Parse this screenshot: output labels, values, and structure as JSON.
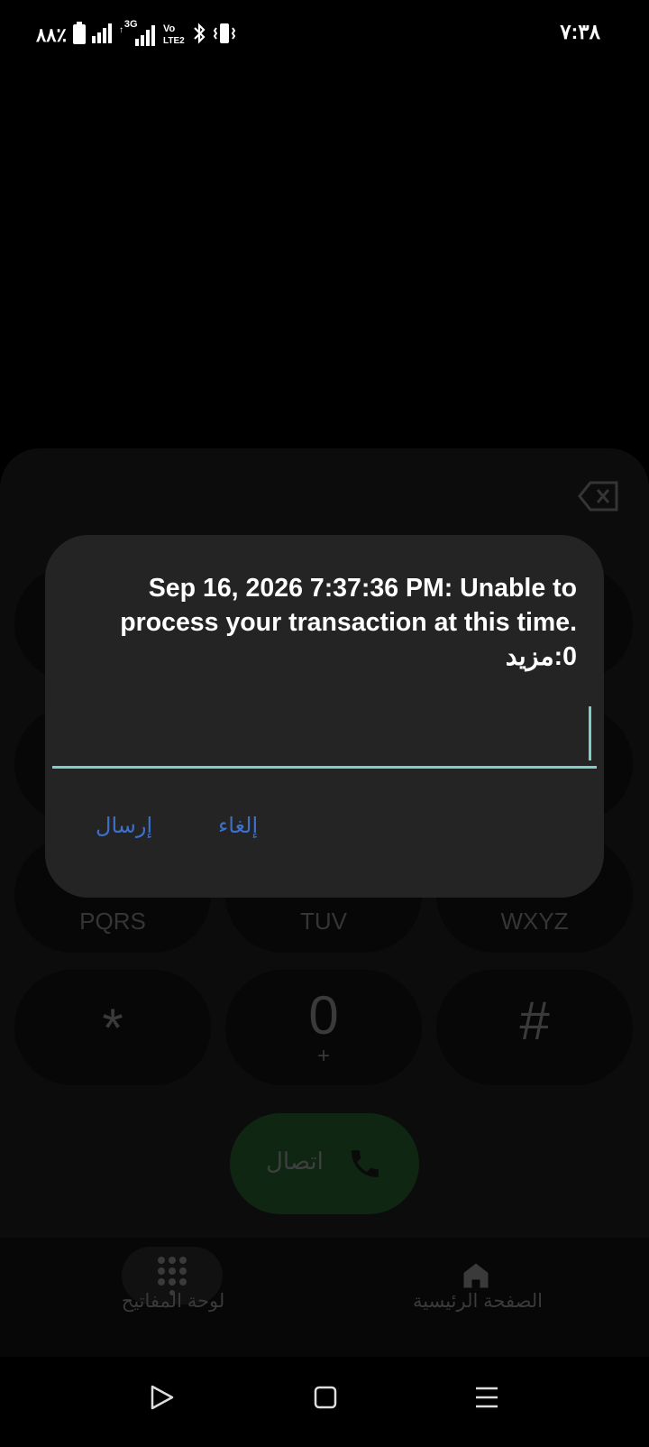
{
  "status_bar": {
    "battery_percent": "٨٨٪",
    "network": "3G",
    "volte": "Vo LTE2",
    "time": "٧:٣٨",
    "icons": [
      "battery-icon",
      "signal-icon",
      "signal-3g-icon",
      "volte-icon",
      "bluetooth-icon",
      "vibrate-icon"
    ]
  },
  "dialer": {
    "keys": [
      {
        "letters": "PQRS",
        "main": "",
        "sub": ""
      },
      {
        "letters": "TUV",
        "main": "",
        "sub": ""
      },
      {
        "letters": "WXYZ",
        "main": "",
        "sub": ""
      },
      {
        "letters": "",
        "main": "*",
        "sub": ""
      },
      {
        "letters": "",
        "main": "0",
        "sub": "+"
      },
      {
        "letters": "",
        "main": "#",
        "sub": ""
      }
    ],
    "call_label": "اتصال",
    "call_color": "#0e2612"
  },
  "bottom_nav": {
    "keypad_label": "لوحة المفاتيح",
    "home_label": "الصفحة الرئيسية"
  },
  "dialog": {
    "message_line1": "Sep 16, 2026 7:37:36 PM: Unable to",
    "message_line2": ".process your transaction at this time",
    "message_line3": "0:مزيد",
    "input_value": "",
    "send_label": "إرسال",
    "cancel_label": "إلغاء",
    "accent": "#3e6fc9",
    "underline": "#7fcfc8"
  }
}
